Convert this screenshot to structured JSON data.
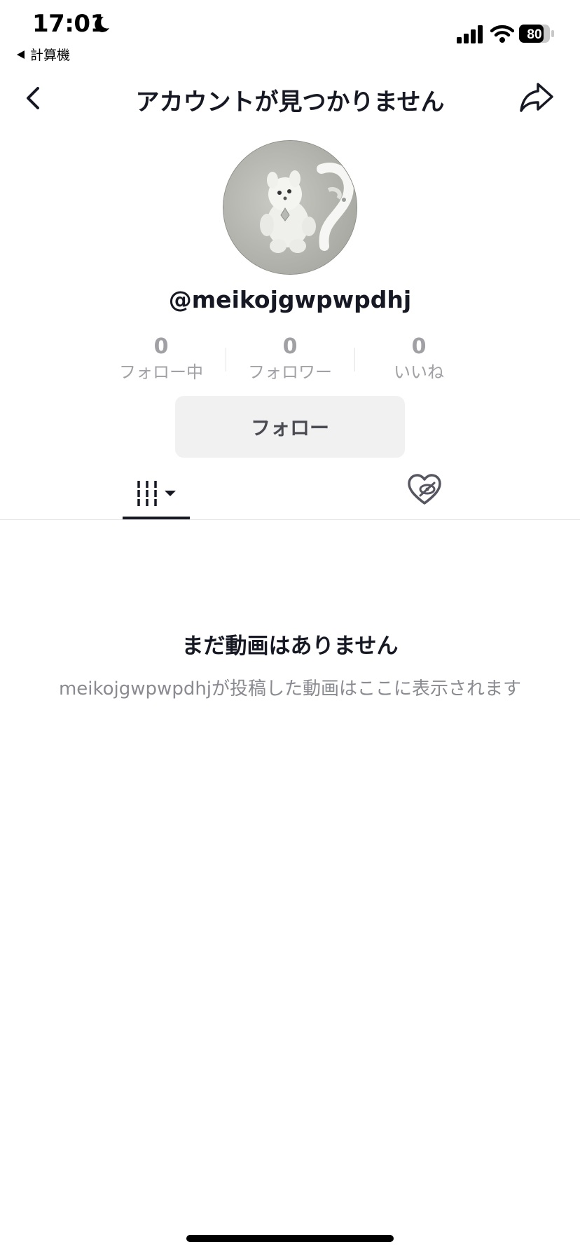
{
  "status_bar": {
    "time": "17:01",
    "back_app_label": "計算機",
    "battery_percent": "80",
    "battery_level": 0.8
  },
  "nav": {
    "title": "アカウントが見つかりません"
  },
  "profile": {
    "username": "@meikojgwpwpdhj",
    "stats": [
      {
        "value": "0",
        "label": "フォロー中"
      },
      {
        "value": "0",
        "label": "フォロワー"
      },
      {
        "value": "0",
        "label": "いいね"
      }
    ],
    "follow_label": "フォロー"
  },
  "tabs": {
    "videos_icon": "video-grid-icon",
    "liked_icon": "hidden-likes-icon",
    "active": "videos"
  },
  "empty_state": {
    "title": "まだ動画はありません",
    "subtitle": "meikojgwpwpdhjが投稿した動画はここに表示されます"
  }
}
